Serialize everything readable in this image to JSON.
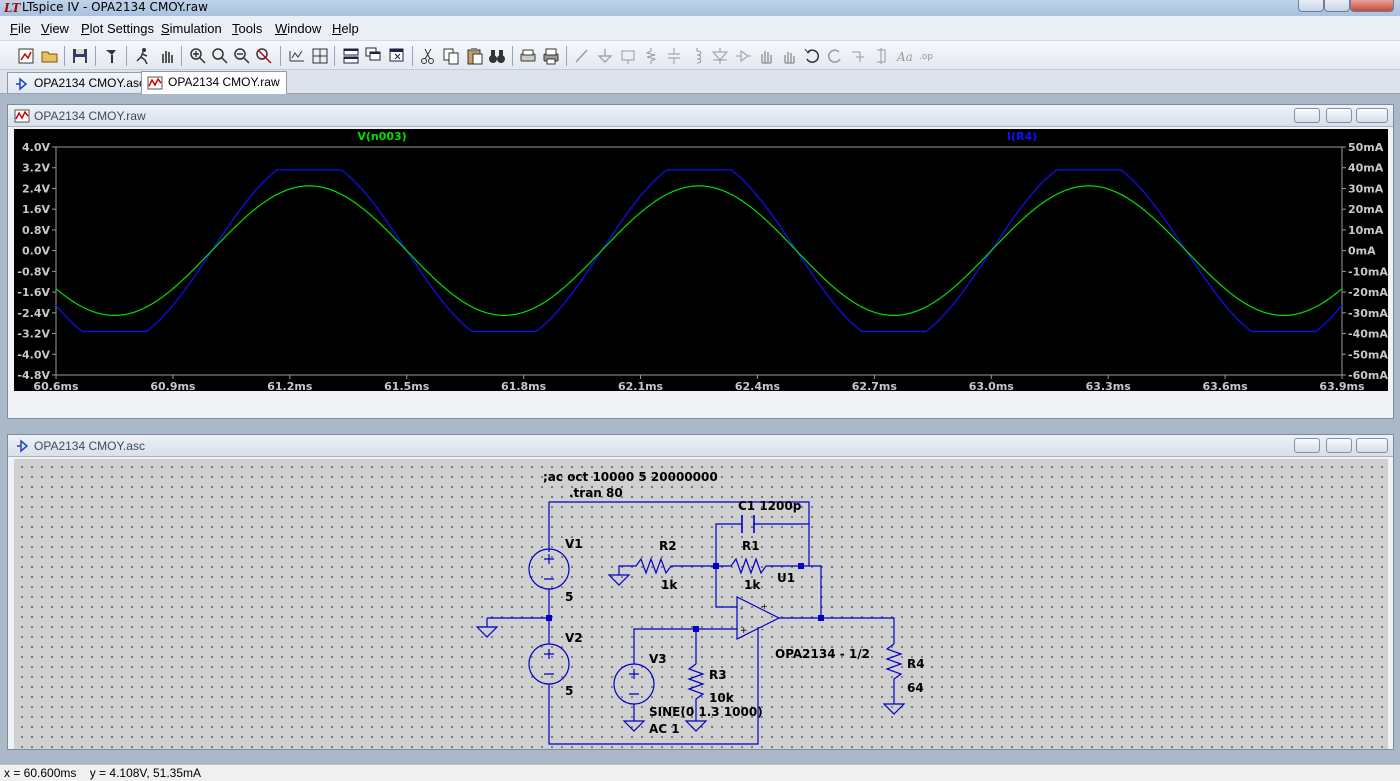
{
  "window": {
    "title": "LTspice IV - OPA2134 CMOY.raw"
  },
  "menu": [
    "File",
    "View",
    "Plot Settings",
    "Simulation",
    "Tools",
    "Window",
    "Help"
  ],
  "menu_mnemonics": [
    "F",
    "V",
    "P",
    "S",
    "T",
    "W",
    "H"
  ],
  "tabs": [
    {
      "label": "OPA2134 CMOY.asc",
      "icon": "schematic-icon"
    },
    {
      "label": "OPA2134 CMOY.raw",
      "icon": "waveform-icon"
    }
  ],
  "waveform_window": {
    "title": "OPA2134 CMOY.raw",
    "chart_data": {
      "type": "line",
      "series": [
        {
          "name": "V(n003)",
          "color": "#00e000",
          "axis": "left",
          "amplitude_estimate": 2.5,
          "period_ms": 1.0
        },
        {
          "name": "I(R4)",
          "color": "#1010ff",
          "axis": "right",
          "amplitude_estimate_mA": 39,
          "clip_mA": 39
        }
      ],
      "x_ticks": [
        "60.6ms",
        "60.9ms",
        "61.2ms",
        "61.5ms",
        "61.8ms",
        "62.1ms",
        "62.4ms",
        "62.7ms",
        "63.0ms",
        "63.3ms",
        "63.6ms",
        "63.9ms"
      ],
      "x_range_ms": [
        60.6,
        63.9
      ],
      "y_left_ticks": [
        "4.0V",
        "3.2V",
        "2.4V",
        "1.6V",
        "0.8V",
        "0.0V",
        "-0.8V",
        "-1.6V",
        "-2.4V",
        "-3.2V",
        "-4.0V",
        "-4.8V"
      ],
      "y_left_range": [
        -4.8,
        4.0
      ],
      "y_right_ticks": [
        "50mA",
        "40mA",
        "30mA",
        "20mA",
        "10mA",
        "0mA",
        "-10mA",
        "-20mA",
        "-30mA",
        "-40mA",
        "-50mA",
        "-60mA"
      ],
      "y_right_range": [
        -60,
        50
      ],
      "grid": false
    }
  },
  "schematic_window": {
    "title": "OPA2134 CMOY.asc",
    "directives": [
      ";ac oct 10000 5 20000000",
      ".tran 80"
    ],
    "labels": {
      "c1": "C1 1200p",
      "v1": "V1",
      "v1_val": "5",
      "v2": "V2",
      "v2_val": "5",
      "v3": "V3",
      "v3_val1": "SINE(0 1.3 1000)",
      "v3_val2": "AC 1",
      "r1": "R1",
      "r1_val": "1k",
      "r2": "R2",
      "r2_val": "1k",
      "r3": "R3",
      "r3_val": "10k",
      "r4": "R4",
      "r4_val": "64",
      "u1": "U1",
      "u1_val": "OPA2134 - 1/2"
    }
  },
  "status": {
    "x": "x = 60.600ms",
    "y": "y = 4.108V, 51.35mA"
  }
}
